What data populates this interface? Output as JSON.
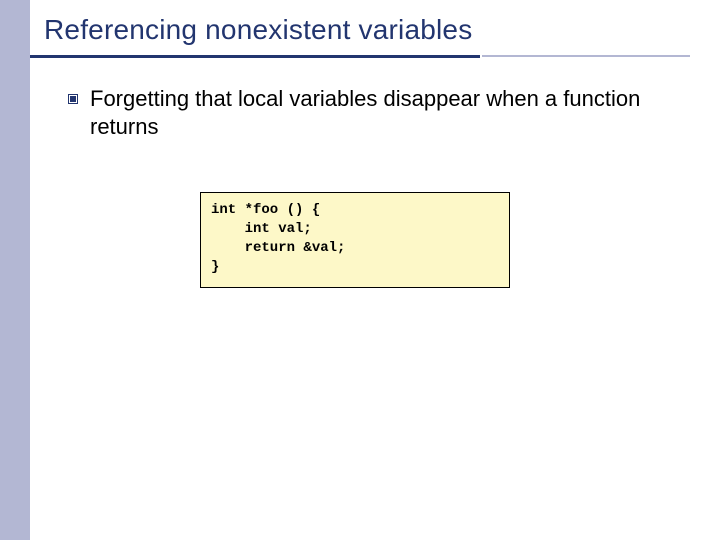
{
  "title": "Referencing nonexistent variables",
  "bullet": "Forgetting that local variables disappear when a function returns",
  "code": "int *foo () {\n    int val;\n    return &val;\n}"
}
